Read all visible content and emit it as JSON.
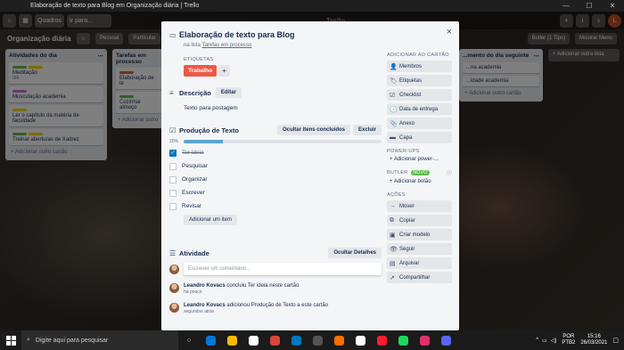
{
  "window": {
    "title": "Elaboração de texto para Blog em Organização diária | Trello",
    "minimize": "—",
    "maximize": "☐",
    "close": "✕"
  },
  "header": {
    "boards_label": "Quadros",
    "search_placeholder": "Ir para...",
    "logo": "Trello",
    "plus": "+",
    "info": "i",
    "bell": "🔔"
  },
  "board": {
    "name": "Organização diária",
    "chip_personal": "Pessoal",
    "chip_visibility": "Particular",
    "butler": "Butler (1 Tips)",
    "show_menu": "Mostrar Menu"
  },
  "lists": [
    {
      "title": "Atividades do dia",
      "cards": [
        {
          "text": "Meditação",
          "badge": "0/4",
          "labels": [
            "#61bd4f",
            "#f2d600"
          ]
        },
        {
          "text": "Musculação academia",
          "labels": [
            "#c377e0"
          ]
        },
        {
          "text": "Ler o capítulo da matéria de faculdade",
          "labels": [
            "#f2d600"
          ]
        },
        {
          "text": "Treinar aberturas de Xadrez",
          "labels": [
            "#61bd4f",
            "#f2d600"
          ]
        }
      ],
      "add": "+ Adicionar outro cartão"
    },
    {
      "title": "Tarefas em processo",
      "cards": [
        {
          "text": "Elaboração de te",
          "labels": [
            "#eb5a46"
          ]
        },
        {
          "text": "Cozinhar almoço",
          "labels": [
            "#61bd4f"
          ]
        }
      ],
      "add": "+ Adicionar outro"
    },
    {
      "title": "...mento do dia seguinte",
      "cards": [
        {
          "text": "...na academia"
        },
        {
          "text": "...idade academia"
        }
      ],
      "add": "+ Adicionar outro cartão"
    }
  ],
  "add_list": "+ Adicionar outra lista",
  "modal": {
    "title": "Elaboração de texto para Blog",
    "in_list_prefix": "na lista",
    "in_list_link": "Tarefas em processo",
    "labels_header": "ETIQUETAS",
    "label_name": "Trabalho",
    "label_color": "#eb5a46",
    "description_header": "Descrição",
    "edit_button": "Editar",
    "description_text": "Texto para postagem",
    "checklist_header": "Produção de Texto",
    "hide_checked": "Ocultar itens concluídos",
    "delete": "Excluir",
    "progress_text": "20%",
    "progress_value": 0.2,
    "items": [
      {
        "text": "Ter ideia",
        "done": true
      },
      {
        "text": "Pesquisar",
        "done": false
      },
      {
        "text": "Organizar",
        "done": false
      },
      {
        "text": "Escrever",
        "done": false
      },
      {
        "text": "Revisar",
        "done": false
      }
    ],
    "add_item": "Adicionar um item",
    "activity_header": "Atividade",
    "hide_details": "Ocultar Detalhes",
    "comment_placeholder": "Escrever um comentário...",
    "activity": [
      {
        "user": "Leandro Kovacs",
        "action": "concluiu Ter ideia neste cartão",
        "time": "há pouco"
      },
      {
        "user": "Leandro Kovacs",
        "action": "adicionou Produção de Texto a este cartão",
        "time": "segundos atrás"
      }
    ],
    "close": "×",
    "sidebar": {
      "add_header": "ADICIONAR AO CARTÃO",
      "add_items": [
        {
          "label": "Membros",
          "icon": "👤"
        },
        {
          "label": "Etiquetas",
          "icon": "🏷"
        },
        {
          "label": "Checklist",
          "icon": "☑"
        },
        {
          "label": "Data de entrega",
          "icon": "🕓"
        },
        {
          "label": "Anexo",
          "icon": "📎"
        },
        {
          "label": "Capa",
          "icon": "▬"
        }
      ],
      "powerups_header": "POWER-UPS",
      "powerups_add": "+ Adicionar power-...",
      "butler_header": "BUTLER",
      "butler_badge": "NOVO",
      "add_button": "+ Adicionar botão",
      "actions_header": "AÇÕES",
      "actions": [
        {
          "label": "Mover",
          "icon": "→"
        },
        {
          "label": "Copiar",
          "icon": "⧉"
        },
        {
          "label": "Criar modelo",
          "icon": "▣"
        },
        {
          "label": "Seguir",
          "icon": "👁"
        },
        {
          "label": "Arquivar",
          "icon": "▤"
        },
        {
          "label": "Compartilhar",
          "icon": "↗"
        }
      ]
    }
  },
  "taskbar": {
    "search_placeholder": "Digite aqui para pesquisar",
    "lang": "POR",
    "kbd": "PTB2",
    "time": "15:16",
    "date": "26/03/2021",
    "apps": [
      "#0078d7",
      "#ffb900",
      "#ffffff",
      "#db4437",
      "#0079bf",
      "#555555",
      "#ff6d00",
      "#ffffff",
      "#ff1b2d",
      "#1ed760",
      "#e1306c",
      "#5865f2"
    ]
  }
}
